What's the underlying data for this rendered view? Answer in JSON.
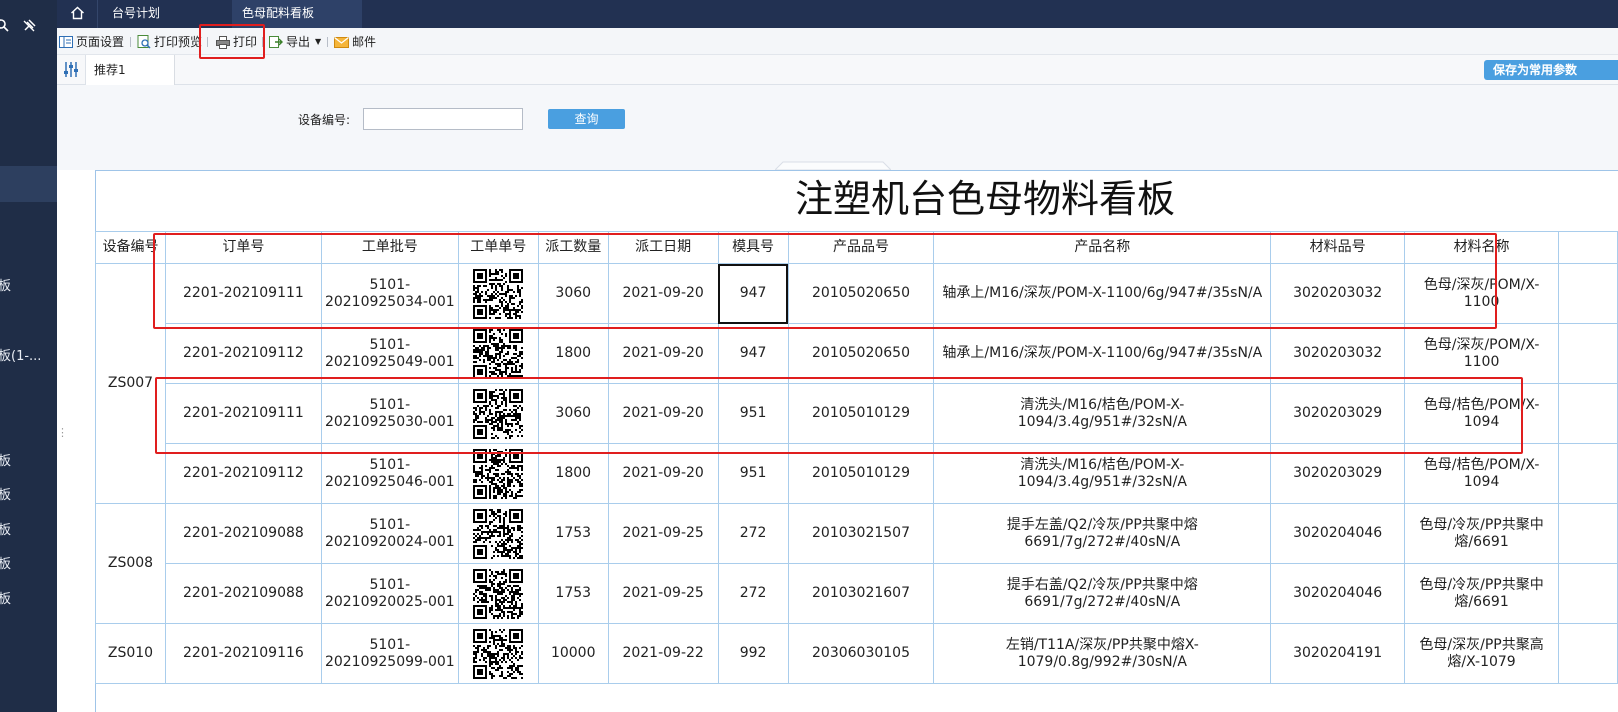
{
  "sidebar": {
    "items": [
      "板",
      "板(1-...",
      "板",
      "板",
      "板",
      "板",
      "板"
    ]
  },
  "tabs": [
    "台号计划",
    "色母配料看板"
  ],
  "toolbar": {
    "page_setup": "页面设置",
    "print_preview": "打印预览",
    "print": "打印",
    "export": "导出",
    "mail": "邮件"
  },
  "param_tab": "推荐1",
  "save_params": "保存为常用参数",
  "query": {
    "label": "设备编号:",
    "value": "",
    "button": "查询"
  },
  "report": {
    "title": "注塑机台色母物料看板",
    "headers": [
      "设备编号",
      "订单号",
      "工单批号",
      "工单单号",
      "派工数量",
      "派工日期",
      "模具号",
      "产品品号",
      "产品名称",
      "材料品号",
      "材料名称"
    ],
    "groups": [
      {
        "device": "ZS007",
        "rows": [
          {
            "order": "2201-202109111",
            "batch": "5101-20210925034-001",
            "qty": "3060",
            "date": "2021-09-20",
            "mold": "947",
            "product_no": "20105020650",
            "product_name": "轴承上/M16/深灰/POM-X-1100/6g/947#/35sN/A",
            "material_no": "3020203032",
            "material_name": "色母/深灰/POM/X-1100"
          },
          {
            "order": "2201-202109112",
            "batch": "5101-20210925049-001",
            "qty": "1800",
            "date": "2021-09-20",
            "mold": "947",
            "product_no": "20105020650",
            "product_name": "轴承上/M16/深灰/POM-X-1100/6g/947#/35sN/A",
            "material_no": "3020203032",
            "material_name": "色母/深灰/POM/X-1100"
          },
          {
            "order": "2201-202109111",
            "batch": "5101-20210925030-001",
            "qty": "3060",
            "date": "2021-09-20",
            "mold": "951",
            "product_no": "20105010129",
            "product_name": "清洗头/M16/桔色/POM-X-1094/3.4g/951#/32sN/A",
            "material_no": "3020203029",
            "material_name": "色母/桔色/POM/X-1094"
          },
          {
            "order": "2201-202109112",
            "batch": "5101-20210925046-001",
            "qty": "1800",
            "date": "2021-09-20",
            "mold": "951",
            "product_no": "20105010129",
            "product_name": "清洗头/M16/桔色/POM-X-1094/3.4g/951#/32sN/A",
            "material_no": "3020203029",
            "material_name": "色母/桔色/POM/X-1094"
          }
        ]
      },
      {
        "device": "ZS008",
        "rows": [
          {
            "order": "2201-202109088",
            "batch": "5101-20210920024-001",
            "qty": "1753",
            "date": "2021-09-25",
            "mold": "272",
            "product_no": "20103021507",
            "product_name": "提手左盖/Q2/冷灰/PP共聚中熔6691/7g/272#/40sN/A",
            "material_no": "3020204046",
            "material_name": "色母/冷灰/PP共聚中熔/6691"
          },
          {
            "order": "2201-202109088",
            "batch": "5101-20210920025-001",
            "qty": "1753",
            "date": "2021-09-25",
            "mold": "272",
            "product_no": "20103021607",
            "product_name": "提手右盖/Q2/冷灰/PP共聚中熔6691/7g/272#/40sN/A",
            "material_no": "3020204046",
            "material_name": "色母/冷灰/PP共聚中熔/6691"
          }
        ]
      },
      {
        "device": "ZS010",
        "rows": [
          {
            "order": "2201-202109116",
            "batch": "5101-20210925099-001",
            "qty": "10000",
            "date": "2021-09-22",
            "mold": "992",
            "product_no": "20306030105",
            "product_name": "左销/T11A/深灰/PP共聚中熔X-1079/0.8g/992#/30sN/A",
            "material_no": "3020204191",
            "material_name": "色母/深灰/PP共聚高熔/X-1079"
          }
        ]
      }
    ]
  }
}
